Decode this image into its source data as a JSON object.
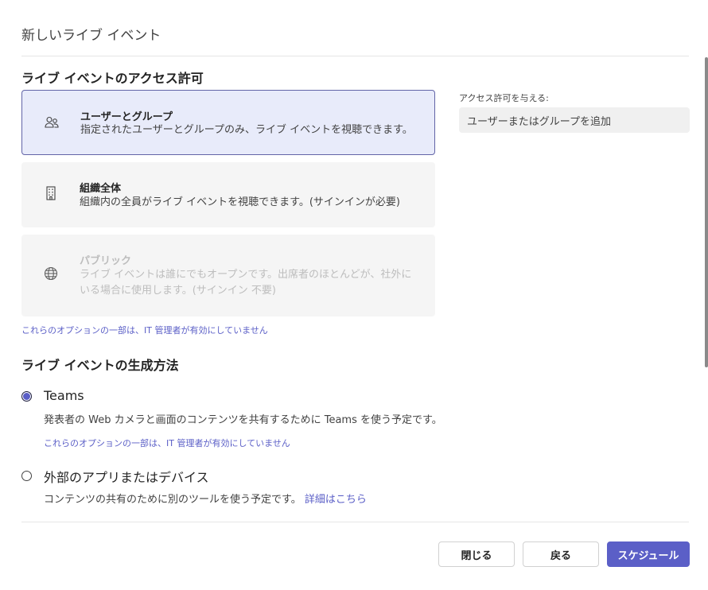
{
  "dialog": {
    "title": "新しいライブ イベント"
  },
  "access": {
    "heading": "ライブ イベントのアクセス許可",
    "options": [
      {
        "icon": "people-icon",
        "title": "ユーザーとグループ",
        "description": "指定されたユーザーとグループのみ、ライブ イベントを視聴できます。",
        "selected": true,
        "disabled": false
      },
      {
        "icon": "building-icon",
        "title": "組織全体",
        "description": "組織内の全員がライブ イベントを視聴できます。(サインインが必要)",
        "selected": false,
        "disabled": false
      },
      {
        "icon": "globe-icon",
        "title": "パブリック",
        "description": "ライブ イベントは誰にでもオープンです。出席者のほとんどが、社外にいる場合に使用します。(サインイン 不要)",
        "selected": false,
        "disabled": true
      }
    ],
    "policy_note": "これらのオプションの一部は、IT 管理者が有効にしていません",
    "grant_label": "アクセス許可を与える:",
    "grant_placeholder": "ユーザーまたはグループを追加"
  },
  "production": {
    "heading": "ライブ イベントの生成方法",
    "teams": {
      "title": "Teams",
      "description": "発表者の Web カメラと画面のコンテンツを共有するために Teams を使う予定です。",
      "policy_note": "これらのオプションの一部は、IT 管理者が有効にしていません",
      "checked": true
    },
    "external": {
      "title": "外部のアプリまたはデバイス",
      "description": "コンテンツの共有のために別のツールを使う予定です。",
      "link": "詳細はこちら",
      "checked": false
    }
  },
  "footer": {
    "close_label": "閉じる",
    "back_label": "戻る",
    "schedule_label": "スケジュール"
  },
  "colors": {
    "accent": "#5b5fc7",
    "selected_card_bg": "#e8ebfa",
    "card_bg": "#f5f5f5"
  }
}
